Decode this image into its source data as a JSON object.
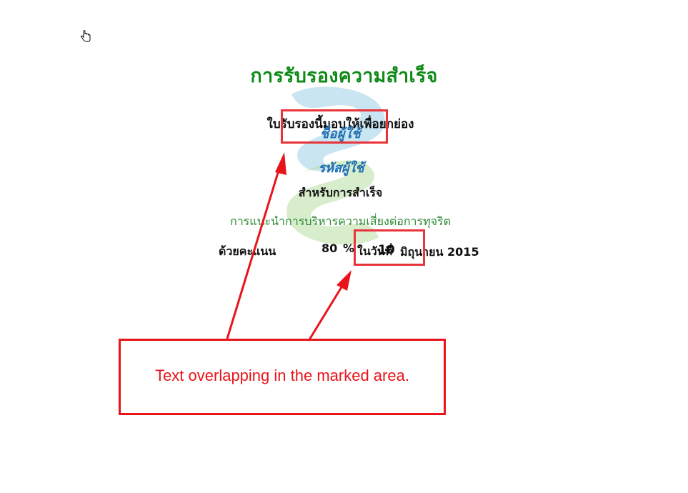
{
  "certificate": {
    "title": "การรับรองความสำเร็จ",
    "award_text": "ใบรับรองนี้มอบให้เพื่อยกย่อง",
    "user_name": "ชื่อผู้ใช้",
    "user_id": "รหัสผู้ใช้",
    "for_achievement": "สำหรับการสำเร็จ",
    "course_name": "การแนะนำการบริหารความเสี่ยงต่อการทุจริต",
    "score_label": "ด้วยคะแนน",
    "score_value": "80",
    "score_unit": "%",
    "date_prefix": "ในวันที่",
    "date_day": "10",
    "date_month_year": "มิถุนายน 2015"
  },
  "callout": {
    "text": "Text overlapping in the marked area."
  },
  "colors": {
    "title": "#0f8a17",
    "user_fields": "#1f6fb2",
    "course_name": "#2f8a36",
    "annotation": "#e8141a",
    "watermark_blue": "#9ccfe6",
    "watermark_green": "#b8dfa0"
  },
  "icons": {
    "cursor": "hand-cursor-icon",
    "watermark": "bank-logo-watermark-icon"
  }
}
